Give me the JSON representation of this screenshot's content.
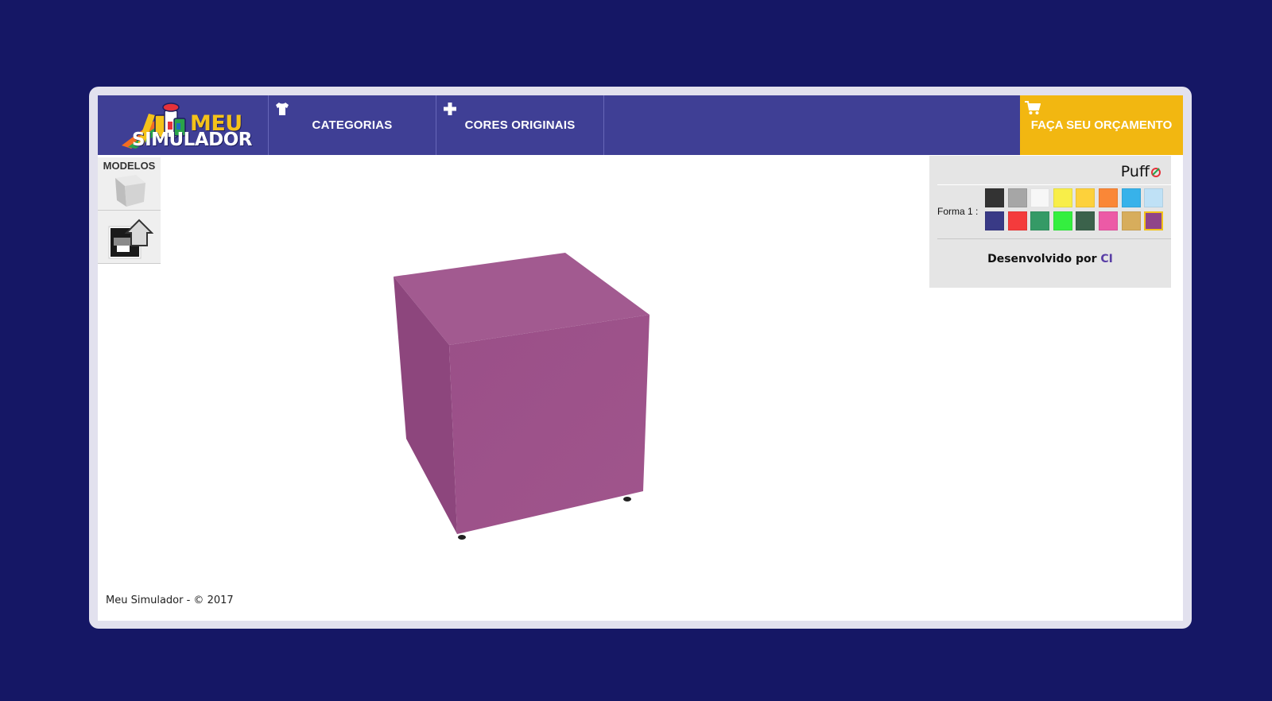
{
  "brand": {
    "logo_top": "MEU",
    "logo_bottom": "SIMULADOR"
  },
  "nav": {
    "categorias": {
      "label": "CATEGORIAS",
      "icon": "tshirt-icon"
    },
    "cores": {
      "label": "CORES ORIGINAIS",
      "icon": "plus-icon"
    },
    "cta": {
      "label": "FAÇA SEU ORÇAMENTO",
      "icon": "cart-icon"
    }
  },
  "models": {
    "title": "MODELOS",
    "items": [
      {
        "icon": "cube-model-icon"
      },
      {
        "icon": "upload-image-icon"
      }
    ]
  },
  "product": {
    "color": "#a0558c"
  },
  "panel": {
    "title": "Puff",
    "forma_label": "Forma 1 :",
    "swatches": [
      "#333333",
      "#a6a6a6",
      "#f7f7f7",
      "#f8ee49",
      "#fdd13b",
      "#fa8737",
      "#37b2ea",
      "#bfe1f6",
      "#393a86",
      "#f43b3c",
      "#359a66",
      "#34ef3f",
      "#3b624b",
      "#ec5aa6",
      "#d7ad5c",
      "#8f4589"
    ],
    "selected_swatch": 15,
    "credit_prefix": "Desenvolvido por",
    "credit_link": "CI"
  },
  "footer": {
    "text": "Meu Simulador - © 2017"
  },
  "colors": {
    "background": "#151765",
    "navbar": "#3f3f95",
    "cta": "#f2b711",
    "panel": "#e5e5e5"
  }
}
